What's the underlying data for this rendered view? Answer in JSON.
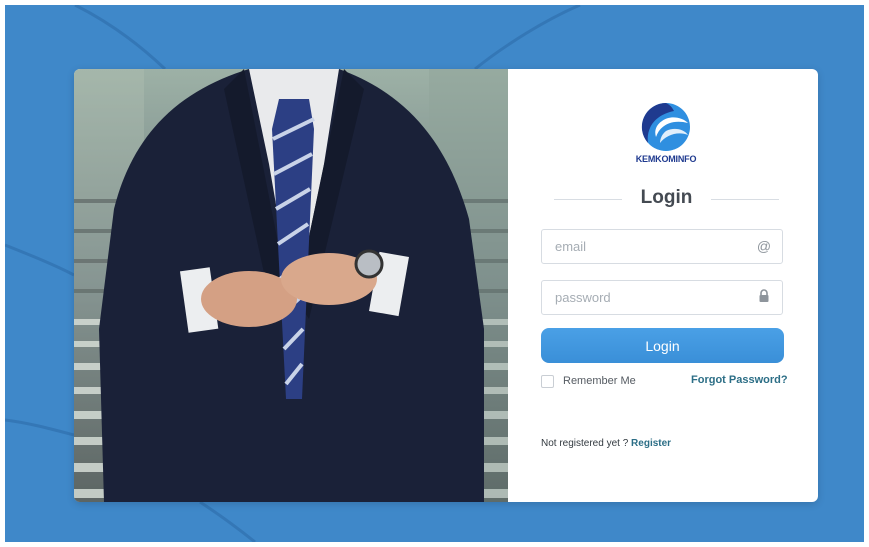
{
  "logo": {
    "text": "KEMKOMINFO",
    "icon": "kemkominfo-logo-icon",
    "colors": {
      "dark_blue": "#1f3a8f",
      "light_blue": "#2f8fe0"
    }
  },
  "form": {
    "heading": "Login",
    "email": {
      "placeholder": "email",
      "icon": "at-sign-icon"
    },
    "password": {
      "placeholder": "password",
      "icon": "lock-icon"
    },
    "submit_label": "Login",
    "remember_label": "Remember Me",
    "forgot_label": "Forgot Password?",
    "register_prompt": "Not registered yet ? ",
    "register_label": "Register"
  },
  "colors": {
    "background": "#3f88c9",
    "accent": "#3a8fd8",
    "link": "#2c6e86"
  }
}
